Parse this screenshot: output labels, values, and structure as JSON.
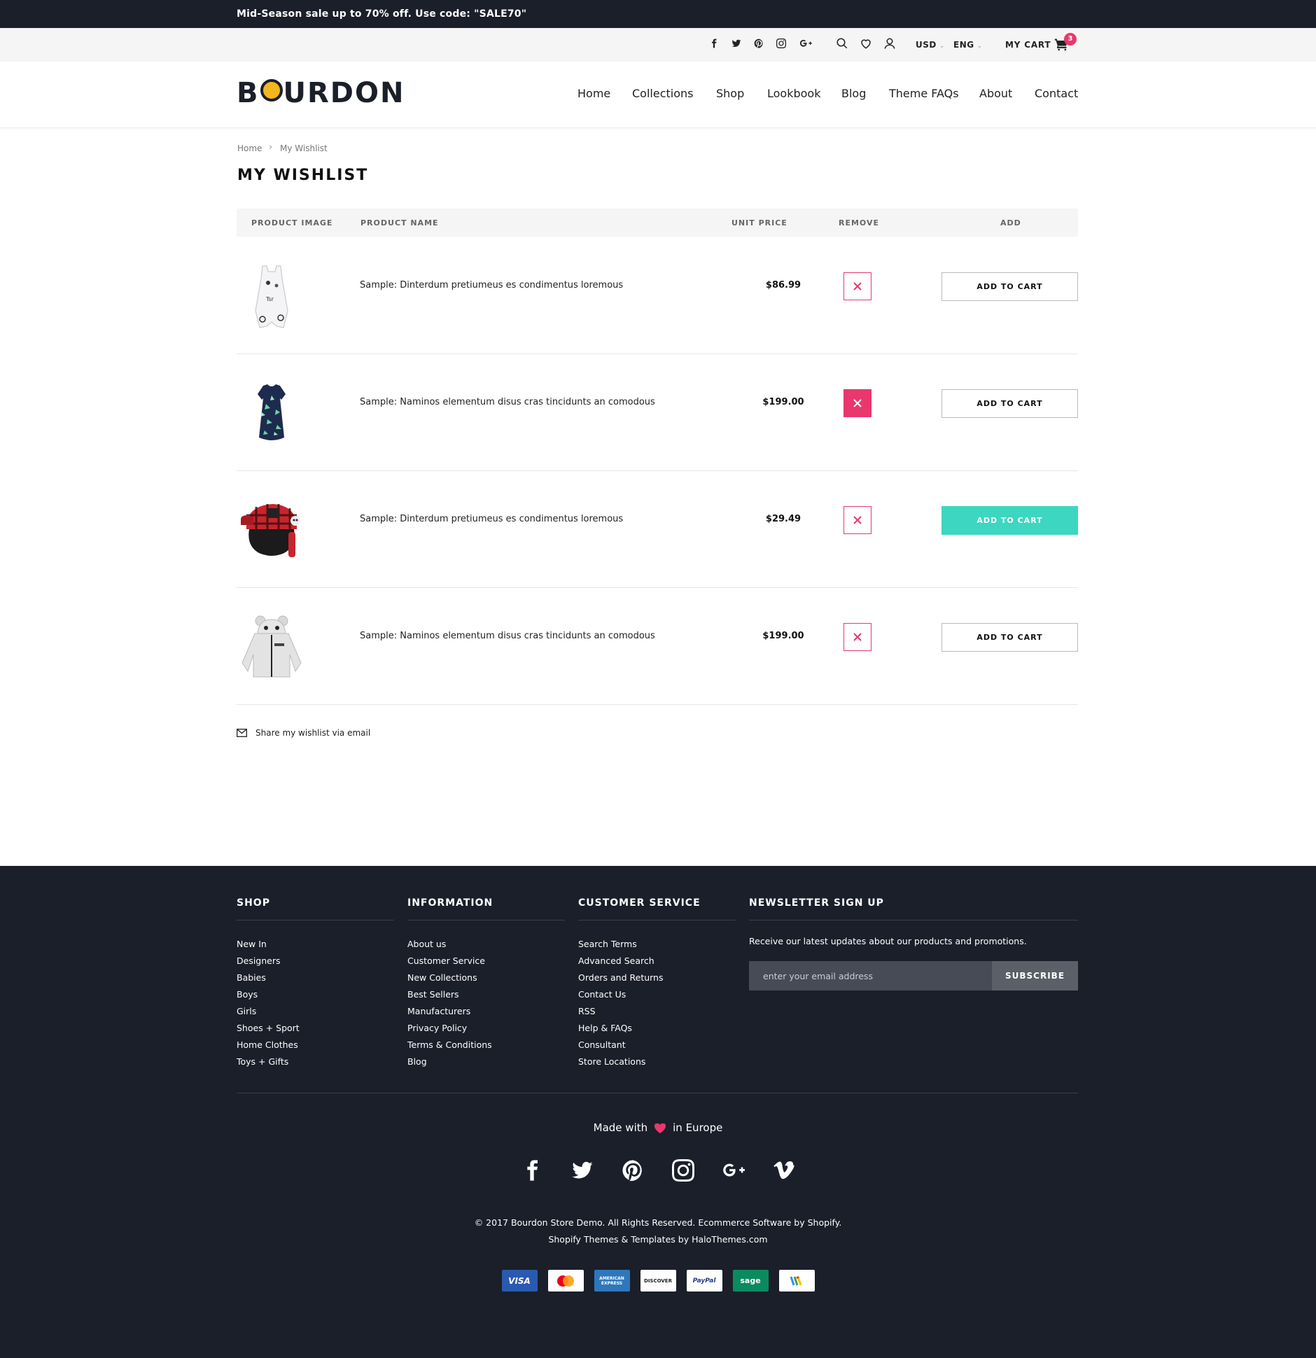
{
  "announcement": "Mid-Season sale up to 70% off. Use code: \"SALE70\"",
  "utility": {
    "currency": "USD",
    "language": "ENG",
    "cart_label": "MY CART",
    "cart_count": "3",
    "social_icons": [
      "facebook-icon",
      "twitter-icon",
      "pinterest-icon",
      "instagram-icon",
      "google-plus-icon"
    ],
    "utility_icons": [
      "search-icon",
      "heart-icon",
      "user-icon"
    ]
  },
  "logo": {
    "text_b": "B",
    "text_rest": "URDON"
  },
  "nav": [
    "Home",
    "Collections",
    "Shop",
    "Lookbook",
    "Blog",
    "Theme FAQs",
    "About",
    "Contact"
  ],
  "breadcrumb": {
    "home": "Home",
    "current": "My Wishlist"
  },
  "page_title": "MY WISHLIST",
  "table": {
    "headers": {
      "image": "PRODUCT IMAGE",
      "name": "PRODUCT NAME",
      "price": "UNIT PRICE",
      "remove": "REMOVE",
      "add": "ADD"
    },
    "rows": [
      {
        "name": "Sample: Dinterdum pretiumeus es condimentus loremous",
        "price": "$86.99",
        "add_label": "ADD TO CART",
        "image": "white-baby-romper"
      },
      {
        "name": "Sample: Naminos elementum disus cras tincidunts an comodous",
        "price": "$199.00",
        "add_label": "ADD TO CART",
        "image": "navy-palm-print-dress"
      },
      {
        "name": "Sample: Dinterdum pretiumeus es condimentus loremous",
        "price": "$29.49",
        "add_label": "ADD TO CART",
        "image": "red-plaid-trapper-hat"
      },
      {
        "name": "Sample: Naminos elementum disus cras tincidunts an comodous",
        "price": "$199.00",
        "add_label": "ADD TO CART",
        "image": "grey-hooded-jacket"
      }
    ]
  },
  "share_text": "Share my wishlist via email",
  "footer": {
    "shop": {
      "title": "SHOP",
      "items": [
        "New In",
        "Designers",
        "Babies",
        "Boys",
        "Girls",
        "Shoes + Sport",
        "Home Clothes",
        "Toys + Gifts"
      ]
    },
    "information": {
      "title": "INFORMATION",
      "items": [
        "About us",
        "Customer Service",
        "New Collections",
        "Best Sellers",
        "Manufacturers",
        "Privacy Policy",
        "Terms & Conditions",
        "Blog"
      ]
    },
    "customer_service": {
      "title": "CUSTOMER SERVICE",
      "items": [
        "Search Terms",
        "Advanced Search",
        "Orders and Returns",
        "Contact Us",
        "RSS",
        "Help & FAQs",
        "Consultant",
        "Store Locations"
      ]
    },
    "newsletter": {
      "title": "NEWSLETTER SIGN UP",
      "text": "Receive our latest updates about our products and promotions.",
      "placeholder": "enter your email address",
      "button": "SUBSCRIBE"
    },
    "made_with_prefix": "Made with",
    "made_with_suffix": "in Europe",
    "social_icons": [
      "facebook-icon",
      "twitter-icon",
      "pinterest-icon",
      "instagram-icon",
      "google-plus-icon",
      "vimeo-icon"
    ],
    "copyright": "© 2017 Bourdon Store Demo. All Rights Reserved. Ecommerce Software by Shopify.",
    "credits": "Shopify Themes & Templates by HaloThemes.com",
    "payments": [
      "VISA",
      "MasterCard",
      "AMERICAN EXPRESS",
      "DISCOVER",
      "PayPal",
      "sage",
      "Google Wallet"
    ]
  },
  "colors": {
    "dark": "#1a1f2a",
    "accent_pink": "#e8386d",
    "accent_teal": "#3dd6c0",
    "logo_yellow": "#f3b61f"
  }
}
